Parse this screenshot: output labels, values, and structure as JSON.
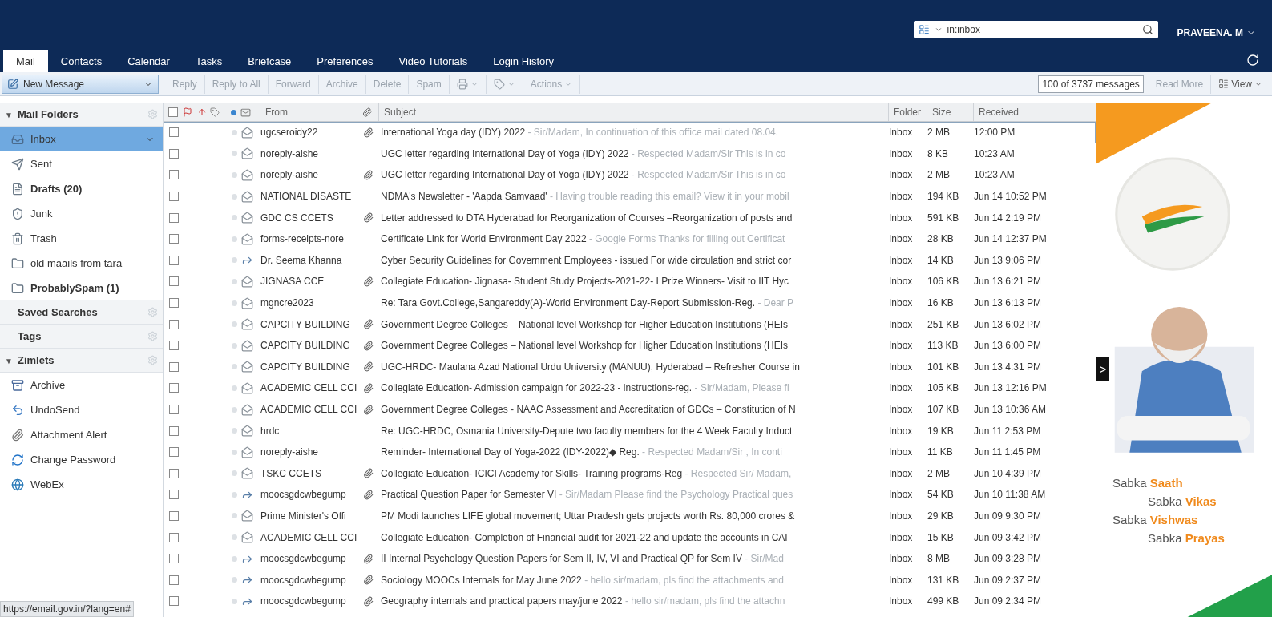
{
  "header": {
    "search": {
      "value": "in:inbox"
    },
    "user": "PRAVEENA. M"
  },
  "tabs": [
    {
      "label": "Mail",
      "selected": true
    },
    {
      "label": "Contacts",
      "selected": false
    },
    {
      "label": "Calendar",
      "selected": false
    },
    {
      "label": "Tasks",
      "selected": false
    },
    {
      "label": "Briefcase",
      "selected": false
    },
    {
      "label": "Preferences",
      "selected": false
    },
    {
      "label": "Video Tutorials",
      "selected": false
    },
    {
      "label": "Login History",
      "selected": false
    }
  ],
  "toolbar": {
    "new_message": "New Message",
    "buttons": [
      {
        "label": "Reply",
        "disabled": true
      },
      {
        "label": "Reply to All",
        "disabled": true
      },
      {
        "label": "Forward",
        "disabled": true
      },
      {
        "label": "Archive",
        "disabled": true
      },
      {
        "label": "Delete",
        "disabled": true
      },
      {
        "label": "Spam",
        "disabled": true
      }
    ],
    "actions": "Actions",
    "count": "100 of 3737 messages",
    "read_more": "Read More",
    "view": "View"
  },
  "sidebar": {
    "sections": [
      {
        "title": "Mail Folders",
        "toggle": "▼",
        "items": [
          {
            "label": "Inbox",
            "kind": "inbox",
            "selected": true,
            "unread": false
          },
          {
            "label": "Sent",
            "kind": "sent",
            "selected": false,
            "unread": false
          },
          {
            "label": "Drafts (20)",
            "kind": "drafts",
            "selected": false,
            "unread": true
          },
          {
            "label": "Junk",
            "kind": "junk",
            "selected": false,
            "unread": false
          },
          {
            "label": "Trash",
            "kind": "trash",
            "selected": false,
            "unread": false
          },
          {
            "label": "old maails from tara",
            "kind": "folder",
            "selected": false,
            "unread": false
          },
          {
            "label": "ProbablySpam (1)",
            "kind": "folder",
            "selected": false,
            "unread": true
          }
        ]
      },
      {
        "title": "Saved Searches"
      },
      {
        "title": "Tags"
      },
      {
        "title": "Zimlets",
        "toggle": "▼",
        "items": [
          {
            "label": "Archive",
            "kind": "archive",
            "selected": false,
            "unread": false
          },
          {
            "label": "UndoSend",
            "kind": "undo",
            "selected": false,
            "unread": false
          },
          {
            "label": "Attachment Alert",
            "kind": "attachment",
            "selected": false,
            "unread": false
          },
          {
            "label": "Change Password",
            "kind": "password",
            "selected": false,
            "unread": false
          },
          {
            "label": "WebEx",
            "kind": "webex",
            "selected": false,
            "unread": false
          }
        ]
      }
    ]
  },
  "status_url": "https://email.gov.in/?lang=en#",
  "table": {
    "select_all_checked": false,
    "columns": {
      "from": "From",
      "subject": "Subject",
      "folder": "Folder",
      "size": "Size",
      "received": "Received"
    },
    "rows": [
      {
        "from": "ugcseroidy22",
        "kind": "read",
        "attachment": true,
        "subject": "International Yoga day (IDY) 2022",
        "fragment": "- Sir/Madam, In continuation of this office mail dated 08.04.",
        "folder": "Inbox",
        "size": "2 MB",
        "received": "12:00 PM",
        "selected": true,
        "checked": false
      },
      {
        "from": "noreply-aishe",
        "kind": "read",
        "attachment": false,
        "subject": "UGC letter regarding International Day of Yoga (IDY) 2022",
        "fragment": "- Respected Madam/Sir This is in co",
        "folder": "Inbox",
        "size": "8 KB",
        "received": "10:23 AM",
        "selected": false,
        "checked": false
      },
      {
        "from": "noreply-aishe",
        "kind": "read",
        "attachment": true,
        "subject": "UGC letter regarding International Day of Yoga (IDY) 2022",
        "fragment": "- Respected Madam/Sir This is in co",
        "folder": "Inbox",
        "size": "2 MB",
        "received": "10:23 AM",
        "selected": false,
        "checked": false
      },
      {
        "from": "NATIONAL DISASTE",
        "kind": "read",
        "attachment": false,
        "subject": "NDMA's Newsletter - 'Aapda Samvaad'",
        "fragment": "- Having trouble reading this email? View it in your mobil",
        "folder": "Inbox",
        "size": "194 KB",
        "received": "Jun 14 10:52 PM",
        "selected": false,
        "checked": false
      },
      {
        "from": "GDC CS CCETS",
        "kind": "read",
        "attachment": true,
        "subject": "Letter addressed to DTA Hyderabad for Reorganization of Courses –Reorganization of posts and",
        "folder": "Inbox",
        "size": "591 KB",
        "received": "Jun 14 2:19 PM",
        "selected": false,
        "checked": false
      },
      {
        "from": "forms-receipts-nore",
        "kind": "read",
        "attachment": false,
        "subject": "Certificate Link for World Environment Day 2022",
        "fragment": "- Google Forms Thanks for filling out Certificat",
        "folder": "Inbox",
        "size": "28 KB",
        "received": "Jun 14 12:37 PM",
        "selected": false,
        "checked": false
      },
      {
        "from": "Dr. Seema Khanna",
        "kind": "forwarded",
        "attachment": false,
        "subject": "Cyber Security Guidelines for Government Employees - issued For wide circulation and strict cor",
        "folder": "Inbox",
        "size": "14 KB",
        "received": "Jun 13 9:06 PM",
        "selected": false,
        "checked": false
      },
      {
        "from": "JIGNASA CCE",
        "kind": "read",
        "attachment": true,
        "subject": "Collegiate Education- Jignasa- Student Study Projects-2021-22- I Prize Winners- Visit to IIT Hyc",
        "folder": "Inbox",
        "size": "106 KB",
        "received": "Jun 13 6:21 PM",
        "selected": false,
        "checked": false
      },
      {
        "from": "mgncre2023",
        "kind": "read",
        "attachment": false,
        "subject": "Re: Tara Govt.College,Sangareddy(A)-World Environment Day-Report Submission-Reg.",
        "fragment": "- Dear P",
        "folder": "Inbox",
        "size": "16 KB",
        "received": "Jun 13 6:13 PM",
        "selected": false,
        "checked": false
      },
      {
        "from": "CAPCITY BUILDING",
        "kind": "read",
        "attachment": true,
        "subject": "Government Degree Colleges – National level Workshop for Higher Education Institutions (HEIs",
        "folder": "Inbox",
        "size": "251 KB",
        "received": "Jun 13 6:02 PM",
        "selected": false,
        "checked": false
      },
      {
        "from": "CAPCITY BUILDING",
        "kind": "read",
        "attachment": true,
        "subject": "Government Degree Colleges – National level Workshop for Higher Education Institutions (HEIs",
        "folder": "Inbox",
        "size": "113 KB",
        "received": "Jun 13 6:00 PM",
        "selected": false,
        "checked": false
      },
      {
        "from": "CAPCITY BUILDING",
        "kind": "read",
        "attachment": true,
        "subject": "UGC-HRDC- Maulana Azad National Urdu University (MANUU), Hyderabad – Refresher Course in",
        "folder": "Inbox",
        "size": "101 KB",
        "received": "Jun 13 4:31 PM",
        "selected": false,
        "checked": false
      },
      {
        "from": "ACADEMIC CELL CCI",
        "kind": "read",
        "attachment": true,
        "subject": "Collegiate Education- Admission campaign for 2022-23 - instructions-reg.",
        "fragment": "- Sir/Madam, Please fi",
        "folder": "Inbox",
        "size": "105 KB",
        "received": "Jun 13 12:16 PM",
        "selected": false,
        "checked": false
      },
      {
        "from": "ACADEMIC CELL CCI",
        "kind": "read",
        "attachment": true,
        "subject": "Government Degree Colleges - NAAC Assessment and Accreditation of GDCs – Constitution of N",
        "folder": "Inbox",
        "size": "107 KB",
        "received": "Jun 13 10:36 AM",
        "selected": false,
        "checked": false
      },
      {
        "from": "hrdc",
        "kind": "read",
        "attachment": false,
        "subject": "Re: UGC-HRDC, Osmania University-Depute two faculty members for the 4 Week Faculty Induct",
        "folder": "Inbox",
        "size": "19 KB",
        "received": "Jun 11 2:53 PM",
        "selected": false,
        "checked": false
      },
      {
        "from": "noreply-aishe",
        "kind": "read",
        "attachment": false,
        "subject": "Reminder- International Day of Yoga-2022 (IDY-2022)◆ Reg.",
        "fragment": "- Respected Madam/Sir , In conti",
        "folder": "Inbox",
        "size": "11 KB",
        "received": "Jun 11 1:45 PM",
        "selected": false,
        "checked": false
      },
      {
        "from": "TSKC CCETS",
        "kind": "read",
        "attachment": true,
        "subject": "Collegiate Education- ICICI Academy for Skills- Training programs-Reg",
        "fragment": "- Respected Sir/ Madam,",
        "folder": "Inbox",
        "size": "2 MB",
        "received": "Jun 10 4:39 PM",
        "selected": false,
        "checked": false
      },
      {
        "from": "moocsgdcwbegump",
        "kind": "forwarded",
        "attachment": true,
        "subject": "Practical Question Paper for Semester VI",
        "fragment": "- Sir/Madam Please find the Psychology Practical ques",
        "folder": "Inbox",
        "size": "54 KB",
        "received": "Jun 10 11:38 AM",
        "selected": false,
        "checked": false
      },
      {
        "from": "Prime Minister's Offi",
        "kind": "read",
        "attachment": false,
        "subject": "PM Modi launches LIFE global movement; Uttar Pradesh gets projects worth Rs. 80,000 crores &",
        "folder": "Inbox",
        "size": "29 KB",
        "received": "Jun 09 9:30 PM",
        "selected": false,
        "checked": false
      },
      {
        "from": "ACADEMIC CELL CCI",
        "kind": "read",
        "attachment": false,
        "subject": "Collegiate Education- Completion of Financial audit for 2021-22 and update the accounts in CAI",
        "folder": "Inbox",
        "size": "15 KB",
        "received": "Jun 09 3:42 PM",
        "selected": false,
        "checked": false
      },
      {
        "from": "moocsgdcwbegump",
        "kind": "forwarded",
        "attachment": true,
        "subject": "II Internal Psychology Question Papers for Sem II, IV, VI and Practical QP for Sem IV",
        "fragment": "- Sir/Mad",
        "folder": "Inbox",
        "size": "8 MB",
        "received": "Jun 09 3:28 PM",
        "selected": false,
        "checked": false
      },
      {
        "from": "moocsgdcwbegump",
        "kind": "forwarded",
        "attachment": true,
        "subject": "Sociology MOOCs Internals for May June 2022",
        "fragment": "- hello sir/madam, pls find the attachments and",
        "folder": "Inbox",
        "size": "131 KB",
        "received": "Jun 09 2:37 PM",
        "selected": false,
        "checked": false
      },
      {
        "from": "moocsgdcwbegump",
        "kind": "forwarded",
        "attachment": true,
        "subject": "Geography internals and practical papers may/june 2022",
        "fragment": "- hello sir/madam, pls find the attachn",
        "folder": "Inbox",
        "size": "499 KB",
        "received": "Jun 09 2:34 PM",
        "selected": false,
        "checked": false
      }
    ]
  },
  "ad": {
    "collapse": ">",
    "lines": [
      "Sabka **Saath**",
      "Sabka **Vikas**",
      "Sabka **Vishwas**",
      "Sabka **Prayas**"
    ]
  }
}
